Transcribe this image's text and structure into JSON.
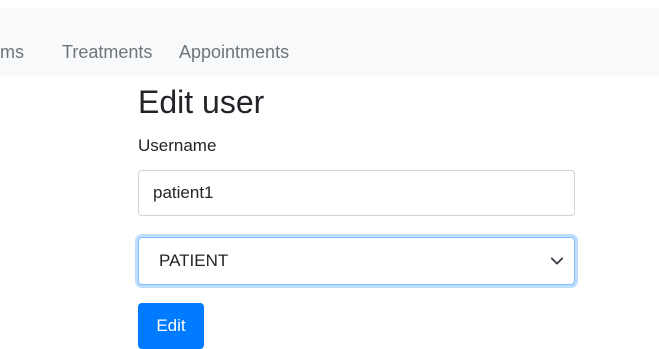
{
  "nav": {
    "items": [
      {
        "label": "oms"
      },
      {
        "label": "Treatments"
      },
      {
        "label": "Appointments"
      }
    ]
  },
  "form": {
    "title": "Edit user",
    "username_label": "Username",
    "username_value": "patient1",
    "role_selected": "PATIENT",
    "submit_label": "Edit"
  },
  "colors": {
    "primary": "#007bff",
    "navbar_bg": "#f8f9fa",
    "nav_link": "#6c757d",
    "focus_border": "#80bdff"
  }
}
